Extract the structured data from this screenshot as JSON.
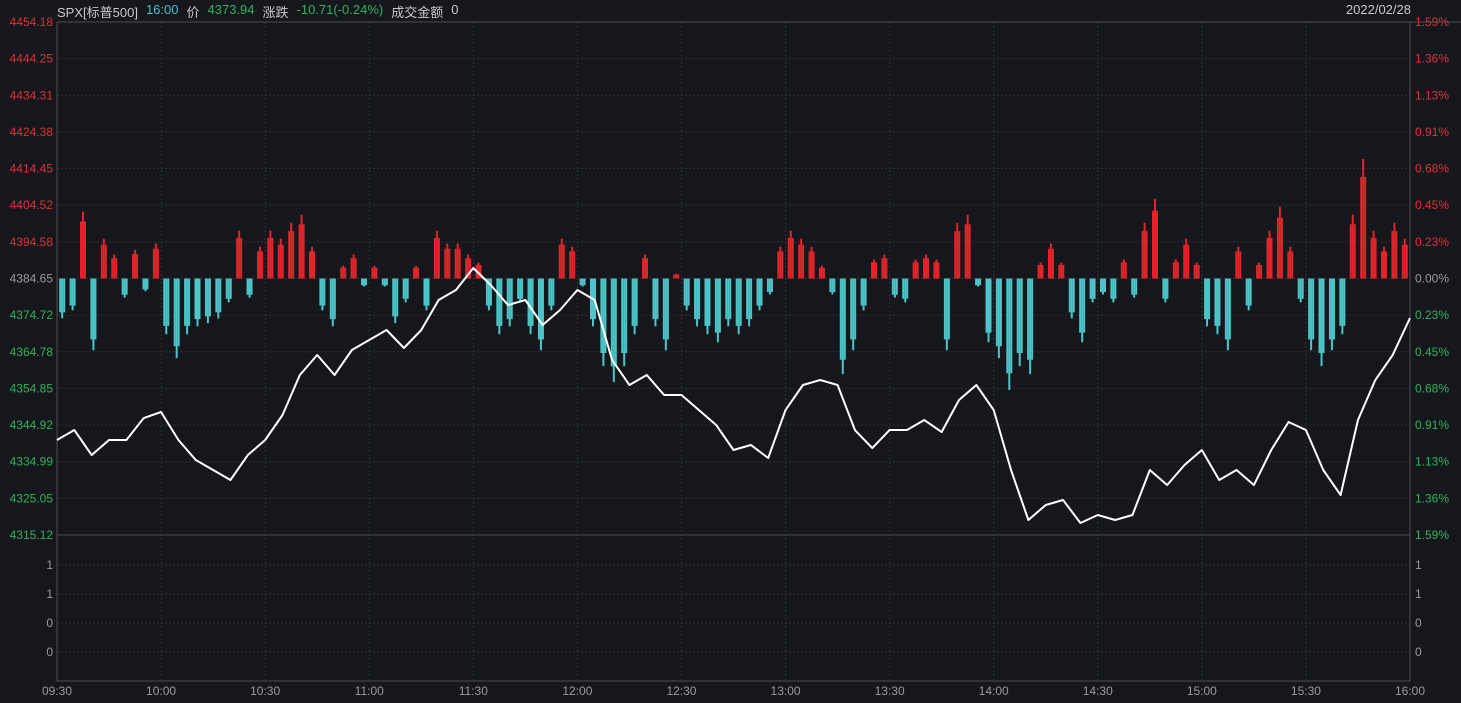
{
  "header": {
    "symbol": "SPX[标普500]",
    "time": "16:00",
    "price_label": "价",
    "price": "4373.94",
    "change_label": "涨跌",
    "change": "-10.71(-0.24%)",
    "amount_label": "成交金额",
    "amount": "0",
    "date": "2022/02/28"
  },
  "colors": {
    "background": "#15171c",
    "up": "#e0252b",
    "down": "#4cc6c9",
    "line": "#ffffff",
    "up_text": "#e0303a",
    "down_text": "#2fb35a",
    "neutral_text": "#9a9a9a"
  },
  "chart_data": [
    {
      "type": "line",
      "title": "",
      "x": [
        "09:30",
        "09:35",
        "09:40",
        "09:45",
        "09:50",
        "09:55",
        "10:00",
        "10:05",
        "10:10",
        "10:15",
        "10:20",
        "10:25",
        "10:30",
        "10:35",
        "10:40",
        "10:45",
        "10:50",
        "10:55",
        "11:00",
        "11:05",
        "11:10",
        "11:15",
        "11:20",
        "11:25",
        "11:30",
        "11:35",
        "11:40",
        "11:45",
        "11:50",
        "11:55",
        "12:00",
        "12:05",
        "12:10",
        "12:15",
        "12:20",
        "12:25",
        "12:30",
        "12:35",
        "12:40",
        "12:45",
        "12:50",
        "12:55",
        "13:00",
        "13:05",
        "13:10",
        "13:15",
        "13:20",
        "13:25",
        "13:30",
        "13:35",
        "13:40",
        "13:45",
        "13:50",
        "13:55",
        "14:00",
        "14:05",
        "14:10",
        "14:15",
        "14:20",
        "14:25",
        "14:30",
        "14:35",
        "14:40",
        "14:45",
        "14:50",
        "14:55",
        "15:00",
        "15:05",
        "15:10",
        "15:15",
        "15:20",
        "15:25",
        "15:30",
        "15:35",
        "15:40",
        "15:45",
        "15:50",
        "15:55",
        "16:00"
      ],
      "series": [
        {
          "values": [
            4340.87,
            4343.58,
            4336.8,
            4340.87,
            4340.87,
            4346.83,
            4348.46,
            4340.87,
            4335.45,
            4332.74,
            4330.03,
            4336.8,
            4340.87,
            4347.65,
            4358.49,
            4363.91,
            4358.49,
            4365.27,
            4367.98,
            4370.69,
            4365.81,
            4370.69,
            4378.82,
            4381.53,
            4387.5,
            4382.89,
            4377.47,
            4378.82,
            4372.04,
            4376.11,
            4381.53,
            4378.82,
            4362.56,
            4355.78,
            4358.49,
            4353.07,
            4353.07,
            4349.0,
            4344.94,
            4338.16,
            4339.52,
            4335.99,
            4349.0,
            4355.78,
            4357.13,
            4355.78,
            4343.58,
            4338.7,
            4343.58,
            4343.58,
            4346.29,
            4343.04,
            4351.71,
            4355.78,
            4349.0,
            4332.74,
            4319.18,
            4323.25,
            4324.61,
            4318.37,
            4320.54,
            4319.18,
            4320.54,
            4332.74,
            4328.67,
            4334.09,
            4338.16,
            4330.03,
            4332.74,
            4328.67,
            4338.16,
            4345.75,
            4343.58,
            4332.74,
            4325.96,
            4346.29,
            4357.13,
            4363.91,
            4373.94
          ]
        }
      ],
      "ylim": [
        4315.12,
        4454.18
      ],
      "left_ticks": [
        "4454.18",
        "4444.25",
        "4434.31",
        "4424.38",
        "4414.45",
        "4404.52",
        "4394.58",
        "4384.65",
        "4374.72",
        "4364.78",
        "4354.85",
        "4344.92",
        "4334.99",
        "4325.05",
        "4315.12"
      ],
      "right_ticks": [
        "1.59%",
        "1.36%",
        "1.13%",
        "0.91%",
        "0.68%",
        "0.45%",
        "0.23%",
        "0.00%",
        "0.23%",
        "0.45%",
        "0.68%",
        "0.91%",
        "1.13%",
        "1.36%",
        "1.59%"
      ],
      "x_ticks": [
        "09:30",
        "10:00",
        "10:30",
        "11:00",
        "11:30",
        "12:00",
        "12:30",
        "13:00",
        "13:30",
        "14:00",
        "14:30",
        "15:00",
        "15:30",
        "16:00"
      ],
      "grid": true
    },
    {
      "type": "bar",
      "x_range": [
        "09:30",
        "16:00"
      ],
      "values": [
        -0.25,
        -0.2,
        0.42,
        -0.45,
        0.25,
        0.15,
        -0.12,
        0.18,
        -0.08,
        0.22,
        -0.35,
        -0.5,
        -0.35,
        -0.3,
        -0.28,
        -0.25,
        -0.15,
        0.3,
        -0.12,
        0.2,
        0.3,
        0.25,
        0.35,
        0.4,
        0.2,
        -0.2,
        -0.3,
        0.08,
        0.15,
        -0.05,
        0.08,
        -0.05,
        -0.28,
        -0.15,
        0.08,
        -0.2,
        0.3,
        0.22,
        0.22,
        0.15,
        0.1,
        -0.2,
        -0.35,
        -0.3,
        -0.15,
        -0.35,
        -0.45,
        -0.2,
        0.25,
        0.2,
        -0.05,
        -0.3,
        -0.55,
        -0.65,
        -0.55,
        -0.35,
        0.15,
        -0.3,
        -0.45,
        0.03,
        -0.2,
        -0.3,
        -0.35,
        -0.4,
        -0.3,
        -0.35,
        -0.3,
        -0.2,
        -0.1,
        0.2,
        0.3,
        0.25,
        0.2,
        0.08,
        -0.1,
        -0.6,
        -0.45,
        -0.2,
        0.12,
        0.15,
        -0.12,
        -0.15,
        0.12,
        0.15,
        0.12,
        -0.45,
        0.35,
        0.4,
        -0.05,
        -0.4,
        -0.5,
        -0.7,
        -0.55,
        -0.6,
        0.1,
        0.22,
        0.1,
        -0.25,
        -0.4,
        -0.15,
        -0.1,
        -0.15,
        0.12,
        -0.12,
        0.35,
        0.5,
        -0.15,
        0.12,
        0.25,
        0.1,
        -0.3,
        -0.35,
        -0.45,
        0.2,
        -0.2,
        0.1,
        0.3,
        0.45,
        0.2,
        -0.15,
        -0.45,
        -0.55,
        -0.45,
        -0.35,
        0.4,
        0.75,
        0.3,
        0.2,
        0.35,
        0.25
      ]
    },
    {
      "type": "bar",
      "left_ticks": [
        "1",
        "1",
        "0",
        "0"
      ],
      "right_ticks": [
        "1",
        "1",
        "0",
        "0"
      ],
      "values": []
    }
  ]
}
